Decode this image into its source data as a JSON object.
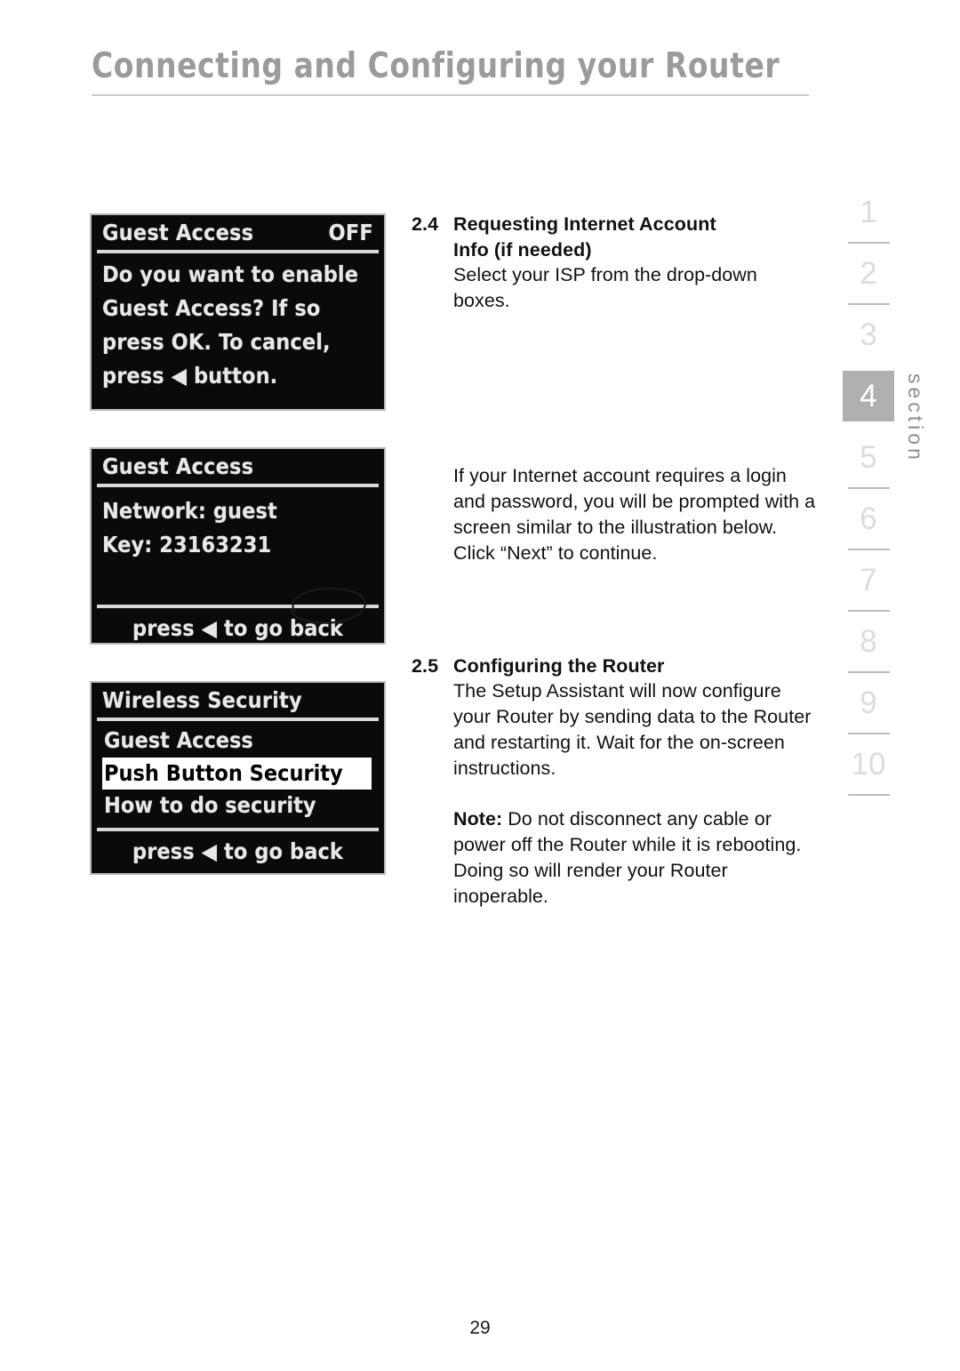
{
  "header": {
    "title": "Connecting and Configuring your Router"
  },
  "lcd_screens": [
    {
      "name": "guest-access-prompt",
      "title": "Guest Access",
      "status": "OFF",
      "lines": [
        "Do you want to enable",
        "Guest Access? If so",
        "press OK. To cancel,",
        "press ◀ button."
      ]
    },
    {
      "name": "guest-access-info",
      "title": "Guest Access",
      "lines": [
        "Network: guest",
        "Key: 23163231"
      ],
      "footer": "press ◀ to go back"
    },
    {
      "name": "wireless-security-menu",
      "title": "Wireless Security",
      "menu": [
        {
          "label": "Guest Access",
          "selected": false
        },
        {
          "label": "Push Button Security",
          "selected": true
        },
        {
          "label": "How to do security",
          "selected": false
        }
      ],
      "footer": "press ◀ to go back"
    }
  ],
  "sections": [
    {
      "number": "2.4",
      "heading_line1": "Requesting Internet Account",
      "heading_line2": "Info (if needed)",
      "body": "Select your ISP from the drop-down boxes."
    },
    {
      "number": "2.5",
      "heading_line1": "Configuring the Router",
      "body": "The Setup Assistant will now configure your Router by sending data to the Router and restarting it. Wait for the on-screen instructions."
    }
  ],
  "paragraphs": {
    "internet_account": "If your Internet account requires a login and password, you will be prompted with a screen similar to the illustration below. Click “Next” to continue.",
    "note_label": "Note:",
    "note_text": " Do not disconnect any cable or power off the Router while it is rebooting. Doing so will render your Router inoperable."
  },
  "section_index": {
    "numbers": [
      "1",
      "2",
      "3",
      "4",
      "5",
      "6",
      "7",
      "8",
      "9",
      "10"
    ],
    "active": "4",
    "label": "section",
    "active_bg": "#b0b0b0",
    "inactive_color": "#dcdcdc"
  },
  "page_number": "29"
}
